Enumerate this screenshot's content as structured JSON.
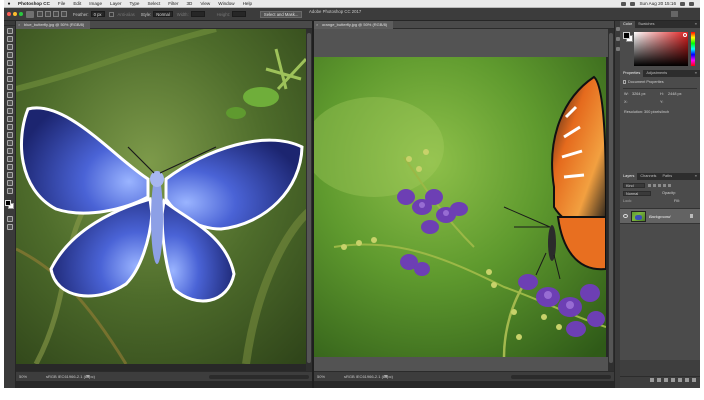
{
  "menubar": {
    "app_name": "Photoshop CC",
    "items": [
      "File",
      "Edit",
      "Image",
      "Layer",
      "Type",
      "Select",
      "Filter",
      "3D",
      "View",
      "Window",
      "Help"
    ],
    "clock": "Sun Aug 20 15:16"
  },
  "window_title": "Adobe Photoshop CC 2017",
  "options": {
    "feather_label": "Feather:",
    "feather_value": "0 px",
    "antialias_label": "Anti-alias",
    "style_label": "Style:",
    "style_value": "Normal",
    "width_label": "Width:",
    "height_label": "Height:",
    "select_mask_label": "Select and Mask..."
  },
  "documents": [
    {
      "tab_title": "blue_butterfly.jpg @ 50% (RGB/8)",
      "zoom": "50%",
      "info": "sRGB IEC61966-2.1 (8bpc)"
    },
    {
      "tab_title": "orange_butterfly.jpg @ 50% (RGB/8)",
      "zoom": "50%",
      "info": "sRGB IEC61966-2.1 (8bpc)"
    }
  ],
  "panels": {
    "color_tabs": [
      "Color",
      "Swatches"
    ],
    "props_tabs": [
      "Properties",
      "Adjustments"
    ],
    "props_title": "Document Properties",
    "props_w_label": "W:",
    "props_w_value": "3264 px",
    "props_h_label": "H:",
    "props_h_value": "2448 px",
    "props_x_label": "X:",
    "props_y_label": "Y:",
    "props_resolution_label": "Resolution:",
    "props_resolution_value": "300 pixels/inch",
    "layers_tabs": [
      "Layers",
      "Channels",
      "Paths"
    ],
    "kind_label": "Kind",
    "blend_label": "Normal",
    "opacity_label": "Opacity:",
    "fill_label": "Fill:",
    "lock_label": "Lock:",
    "layer_name": "Background"
  },
  "colors": {
    "workspace": "#535353",
    "panel": "#4b4b4b",
    "accent_red": "#e02020"
  }
}
